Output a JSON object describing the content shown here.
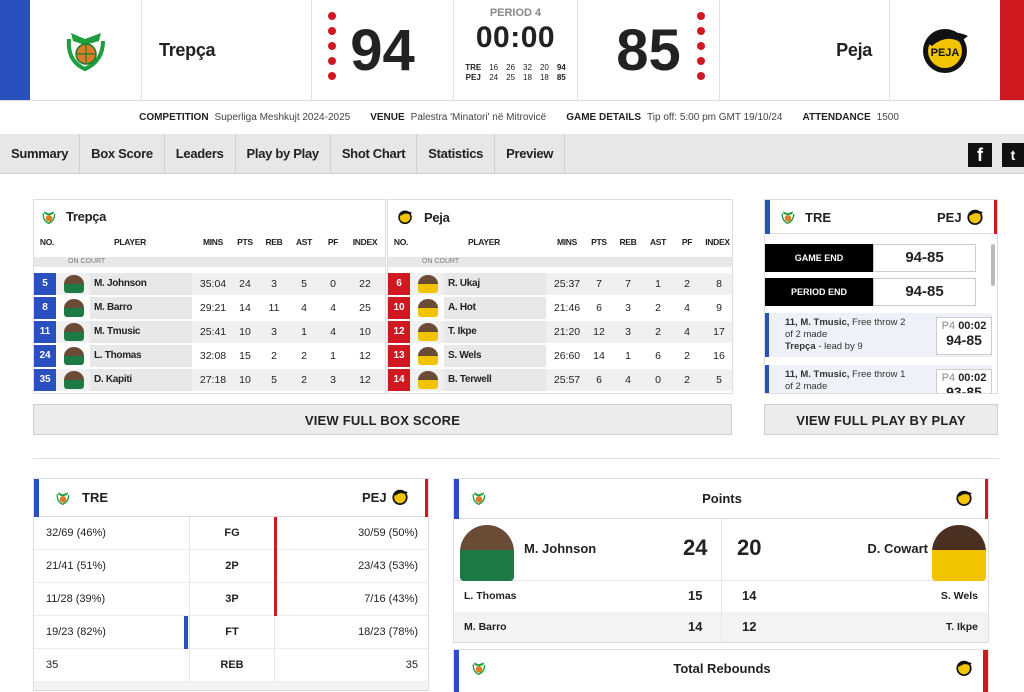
{
  "header": {
    "home_team": "Trepça",
    "away_team": "Peja",
    "home_score": "94",
    "away_score": "85",
    "period": "PERIOD 4",
    "clock": "00:00",
    "quarters": {
      "home_abbr": "TRE",
      "home": [
        "16",
        "26",
        "32",
        "20",
        "94"
      ],
      "away_abbr": "PEJ",
      "away": [
        "24",
        "25",
        "18",
        "18",
        "85"
      ]
    },
    "colors": {
      "home_stripe": "#2a4fbf",
      "away_stripe": "#d01820"
    }
  },
  "info": {
    "competition_label": "COMPETITION",
    "competition": "Superliga Meshkujt 2024-2025",
    "venue_label": "VENUE",
    "venue": "Palestra 'Minatori' në Mitrovicë",
    "details_label": "GAME DETAILS",
    "details": "Tip off: 5:00 pm GMT 19/10/24",
    "attendance_label": "ATTENDANCE",
    "attendance": "1500"
  },
  "nav": {
    "tabs": [
      "Summary",
      "Box Score",
      "Leaders",
      "Play by Play",
      "Shot Chart",
      "Statistics",
      "Preview"
    ],
    "facebook_icon": "facebook-icon",
    "twitter_icon": "twitter-icon"
  },
  "boxscore": {
    "headers": {
      "no": "NO.",
      "player": "PLAYER",
      "mins": "MINS",
      "pts": "PTS",
      "reb": "REB",
      "ast": "AST",
      "pf": "PF",
      "index": "INDEX"
    },
    "on_court": "ON COURT",
    "home": {
      "name": "Trepça",
      "players": [
        {
          "no": "5",
          "name": "M. Johnson",
          "mins": "35:04",
          "pts": "24",
          "reb": "3",
          "ast": "5",
          "pf": "0",
          "index": "22"
        },
        {
          "no": "8",
          "name": "M. Barro",
          "mins": "29:21",
          "pts": "14",
          "reb": "11",
          "ast": "4",
          "pf": "4",
          "index": "25"
        },
        {
          "no": "11",
          "name": "M. Tmusic",
          "mins": "25:41",
          "pts": "10",
          "reb": "3",
          "ast": "1",
          "pf": "4",
          "index": "10"
        },
        {
          "no": "24",
          "name": "L. Thomas",
          "mins": "32:08",
          "pts": "15",
          "reb": "2",
          "ast": "2",
          "pf": "1",
          "index": "12"
        },
        {
          "no": "35",
          "name": "D. Kapiti",
          "mins": "27:18",
          "pts": "10",
          "reb": "5",
          "ast": "2",
          "pf": "3",
          "index": "12"
        }
      ]
    },
    "away": {
      "name": "Peja",
      "players": [
        {
          "no": "6",
          "name": "R. Ukaj",
          "mins": "25:37",
          "pts": "7",
          "reb": "7",
          "ast": "1",
          "pf": "2",
          "index": "8"
        },
        {
          "no": "10",
          "name": "A. Hot",
          "mins": "21:46",
          "pts": "6",
          "reb": "3",
          "ast": "2",
          "pf": "4",
          "index": "9"
        },
        {
          "no": "12",
          "name": "T. Ikpe",
          "mins": "21:20",
          "pts": "12",
          "reb": "3",
          "ast": "2",
          "pf": "4",
          "index": "17"
        },
        {
          "no": "13",
          "name": "S. Wels",
          "mins": "26:60",
          "pts": "14",
          "reb": "1",
          "ast": "6",
          "pf": "2",
          "index": "16"
        },
        {
          "no": "14",
          "name": "B. Terwell",
          "mins": "25:57",
          "pts": "6",
          "reb": "4",
          "ast": "0",
          "pf": "2",
          "index": "5"
        }
      ]
    },
    "view_full": "VIEW FULL BOX SCORE"
  },
  "pbp": {
    "home_abbr": "TRE",
    "away_abbr": "PEJ",
    "game_end_label": "GAME END",
    "game_end_score": "94-85",
    "period_end_label": "PERIOD END",
    "period_end_score": "94-85",
    "events": [
      {
        "who": "11, M. Tmusic,",
        "text": " Free throw 2 of 2 made",
        "lead_team": "Trepça",
        "lead": " - lead by 9",
        "period": "P4",
        "time": "00:02",
        "score": "94-85"
      },
      {
        "who": "11, M. Tmusic,",
        "text": " Free throw 1 of 2 made",
        "lead_team": "",
        "lead": "",
        "period": "P4",
        "time": "00:02",
        "score": "93-85"
      }
    ],
    "view_full": "VIEW FULL PLAY BY PLAY"
  },
  "comparison": {
    "home_abbr": "TRE",
    "away_abbr": "PEJ",
    "rows": [
      {
        "home": "32/69 (46%)",
        "label": "FG",
        "away": "30/59 (50%)",
        "lead": "away"
      },
      {
        "home": "21/41 (51%)",
        "label": "2P",
        "away": "23/43 (53%)",
        "lead": "away"
      },
      {
        "home": "11/28 (39%)",
        "label": "3P",
        "away": "7/16 (43%)",
        "lead": "away"
      },
      {
        "home": "19/23 (82%)",
        "label": "FT",
        "away": "18/23 (78%)",
        "lead": "home"
      },
      {
        "home": "35",
        "label": "REB",
        "away": "35",
        "lead": ""
      }
    ]
  },
  "leaders": {
    "points_title": "Points",
    "top_home": {
      "name": "M. Johnson",
      "value": "24"
    },
    "top_away": {
      "name": "D. Cowart",
      "value": "20"
    },
    "rows": [
      {
        "home_name": "L. Thomas",
        "home_value": "15",
        "away_value": "14",
        "away_name": "S. Wels"
      },
      {
        "home_name": "M. Barro",
        "home_value": "14",
        "away_value": "12",
        "away_name": "T. Ikpe"
      }
    ],
    "rebounds_title": "Total Rebounds"
  }
}
